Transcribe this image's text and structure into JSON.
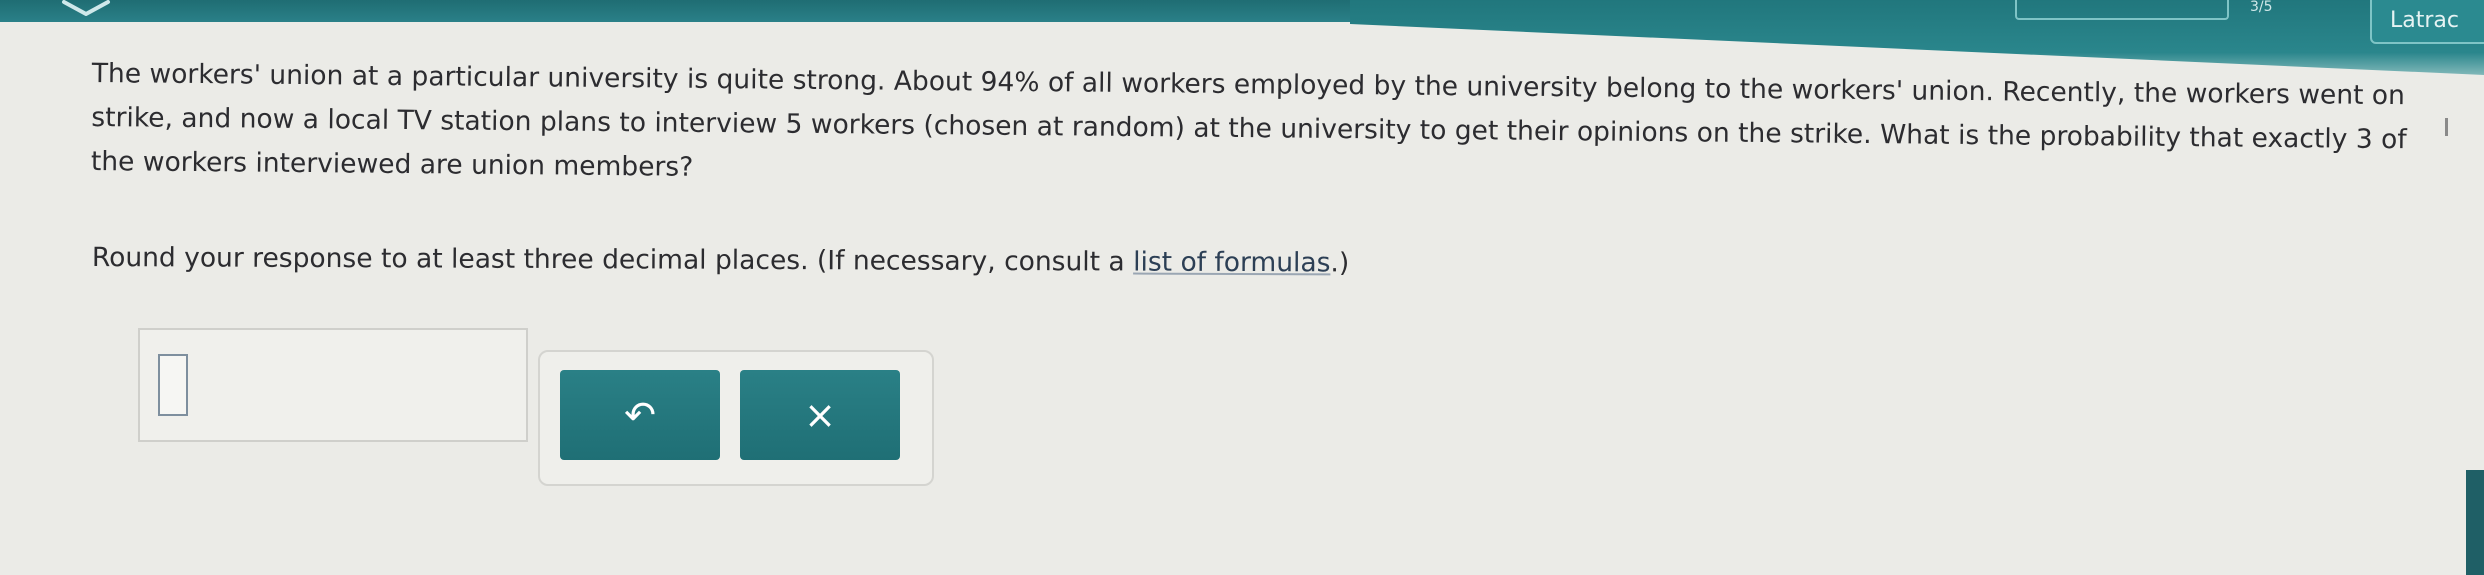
{
  "header": {
    "number_text": "3/5",
    "right_button_label": "Latrac",
    "menu_icon": "chevron-down-icon"
  },
  "question": {
    "text": "The workers' union at a particular university is quite strong. About 94% of all workers employed by the university belong to the workers' union. Recently, the workers went on strike, and now a local TV station plans to interview 5 workers (chosen at random) at the university to get their opinions on the strike. What is the probability that exactly 3 of the workers interviewed are union members?",
    "instruction_prefix": "Round your response to at least three decimal places. (If necessary, consult a ",
    "formula_link": "list of formulas",
    "instruction_suffix": ".)"
  },
  "answer": {
    "value": ""
  },
  "buttons": {
    "undo_icon": "↶",
    "clear_icon": "×"
  },
  "colors": {
    "accent": "#267a80",
    "background": "#ebebe7"
  }
}
